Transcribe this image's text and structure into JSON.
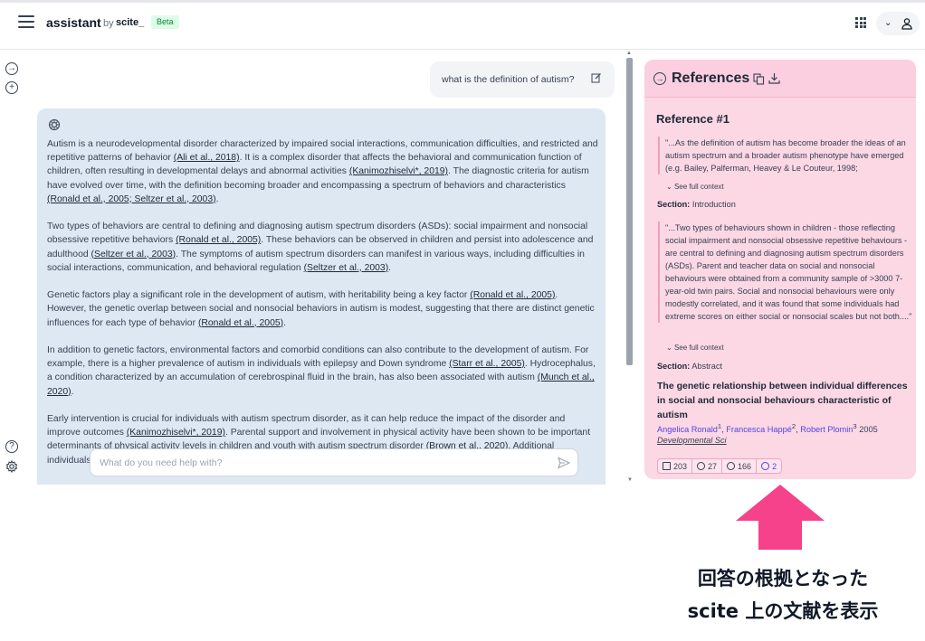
{
  "header": {
    "brand": "assistant",
    "by": "by",
    "scite": "scite_",
    "beta": "Beta"
  },
  "chat": {
    "user_message": "what is the definition of autism?",
    "input_placeholder": "What do you need help with?",
    "answer": {
      "p1": {
        "a": "Autism is a neurodevelopmental disorder characterized by impaired social interactions, communication difficulties, and restricted and repetitive patterns of behavior ",
        "c1": "(Ali et al., 2018)",
        "b": ". It is a complex disorder that affects the behavioral and communication function of children, often resulting in developmental delays and abnormal activities ",
        "c2": "(Kanimozhiselvi*, 2019)",
        "c": ". The diagnostic criteria for autism have evolved over time, with the definition becoming broader and encompassing a spectrum of behaviors and characteristics ",
        "c3": "(Ronald et al., 2005; Seltzer et al., 2003)",
        "d": "."
      },
      "p2": {
        "a": "Two types of behaviors are central to defining and diagnosing autism spectrum disorders (ASDs): social impairment and nonsocial obsessive repetitive behaviors ",
        "c1": "(Ronald et al., 2005)",
        "b": ". These behaviors can be observed in children and persist into adolescence and adulthood ",
        "c2": "(Seltzer et al., 2003)",
        "c": ". The symptoms of autism spectrum disorders can manifest in various ways, including difficulties in social interactions, communication, and behavioral regulation ",
        "c3": "(Seltzer et al., 2003)",
        "d": "."
      },
      "p3": {
        "a": "Genetic factors play a significant role in the development of autism, with heritability being a key factor ",
        "c1": "(Ronald et al., 2005)",
        "b": ". However, the genetic overlap between social and nonsocial behaviors in autism is modest, suggesting that there are distinct genetic influences for each type of behavior ",
        "c2": "(Ronald et al., 2005)",
        "c": "."
      },
      "p4": {
        "a": "In addition to genetic factors, environmental factors and comorbid conditions can also contribute to the development of autism. For example, there is a higher prevalence of autism in individuals with epilepsy and Down syndrome ",
        "c1": "(Starr et al., 2005)",
        "b": ". Hydrocephalus, a condition characterized by an accumulation of cerebrospinal fluid in the brain, has also been associated with autism ",
        "c2": "(Munch et al., 2020)",
        "c": "."
      },
      "p5": {
        "a": "Early intervention is crucial for individuals with autism spectrum disorder, as it can help reduce the impact of the disorder and improve outcomes ",
        "c1": "(Kanimozhiselvi*, 2019)",
        "b": ". Parental support and involvement in physical activity have been shown to be important determinants of physical activity levels in children and youth with autism spectrum disorder ",
        "c2": "(Brown et al., 2020)",
        "c": ". Additional",
        "d": "individuals"
      }
    }
  },
  "references": {
    "title": "References",
    "ref_label": "Reference #1",
    "quote1": "\"...As the definition of autism has become broader the ideas of an autism spectrum and a broader autism phenotype have emerged (e.g. Bailey, Palferman, Heavey & Le Couteur, 1998;",
    "see_context_1": "See full context",
    "section1_label": "Section:",
    "section1_value": "Introduction",
    "quote2": "\"...Two types of behaviours shown in children - those reflecting social impairment and nonsocial obsessive repetitive behaviours - are central to defining and diagnosing autism spectrum disorders (ASDs). Parent and teacher data on social and nonsocial behaviours were obtained from a community sample of >3000 7-year-old twin pairs. Social and nonsocial behaviours were only modestly correlated, and it was found that some individuals had extreme scores on either social or nonsocial scales but not both....\"",
    "see_context_2": "See full context",
    "section2_label": "Section:",
    "section2_value": "Abstract",
    "paper_title": "The genetic relationship between individual differences in social and nonsocial behaviours characteristic of autism",
    "authors": [
      {
        "name": "Angelica Ronald",
        "sup": "1"
      },
      {
        "name": "Francesca Happé",
        "sup": "2"
      },
      {
        "name": "Robert Plomin",
        "sup": "3"
      }
    ],
    "year": "2005",
    "journal": "Developmental Sci",
    "badges": {
      "citing": "203",
      "supporting": "27",
      "mentioning": "166",
      "contrasting": "2"
    }
  },
  "callout": {
    "line1": "回答の根拠となった",
    "line2": "scite 上の文献を表示",
    "arrow_color": "#f6428b"
  },
  "colors": {
    "answer_bg": "#dde8f3",
    "refs_bg": "#fcd7e4",
    "author_link": "#4f46e5"
  }
}
